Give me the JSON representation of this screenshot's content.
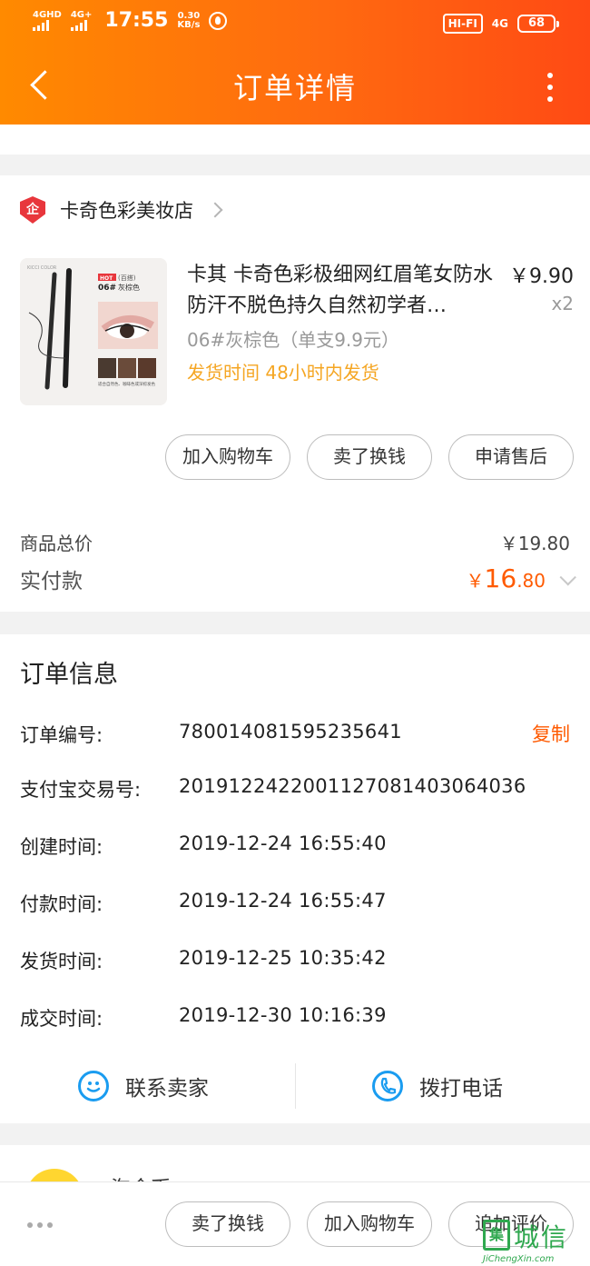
{
  "status_bar": {
    "signal1": "4GHD",
    "signal2": "4G+",
    "time": "17:55",
    "speed_value": "0.30",
    "speed_unit": "KB/s",
    "hifi": "HI-FI",
    "network": "4G",
    "battery": "68"
  },
  "nav": {
    "title": "订单详情"
  },
  "shop": {
    "badge": "企",
    "name": "卡奇色彩美妆店"
  },
  "product": {
    "title": "卡其 卡奇色彩极细网红眉笔女防水防汗不脱色持久自然初学者…",
    "price": "￥9.90",
    "quantity": "x2",
    "spec": "06#灰棕色（单支9.9元）",
    "shipping": "发货时间 48小时内发货",
    "image": {
      "brand": "KICCI COLOR",
      "hot": "HOT",
      "code": "06#",
      "tag": "(百搭)",
      "shade": "灰棕色",
      "caption": "适合自然色、咖啡色或深棕发色"
    }
  },
  "actions": {
    "add_cart": "加入购物车",
    "resell": "卖了换钱",
    "after_sale": "申请售后"
  },
  "summary": {
    "total_label": "商品总价",
    "total_value": "￥19.80",
    "paid_label": "实付款",
    "paid_currency": "￥",
    "paid_int": "16",
    "paid_dec": ".80"
  },
  "order_info": {
    "title": "订单信息",
    "copy_label": "复制",
    "rows": [
      {
        "label": "订单编号:",
        "value": "780014081595235641"
      },
      {
        "label": "支付宝交易号:",
        "value": "2019122422001127081403064036"
      },
      {
        "label": "创建时间:",
        "value": "2019-12-24 16:55:40"
      },
      {
        "label": "付款时间:",
        "value": "2019-12-24 16:55:47"
      },
      {
        "label": "发货时间:",
        "value": "2019-12-25 10:35:42"
      },
      {
        "label": "成交时间:",
        "value": "2019-12-30 10:16:39"
      }
    ]
  },
  "contact": {
    "seller": "联系卖家",
    "phone": "拨打电话"
  },
  "peek": {
    "text": "淘金币"
  },
  "bottom_bar": {
    "resell": "卖了换钱",
    "add_cart": "加入购物车",
    "review": "追加评价"
  },
  "watermark": {
    "char": "集",
    "text": "城信",
    "url": "JiChengXin.com"
  },
  "colors": {
    "header_start": "#ff8a00",
    "header_end": "#ff4a14",
    "accent": "#ff5a00",
    "shipping": "#f5a623",
    "contact_icon": "#1a9cf0"
  }
}
